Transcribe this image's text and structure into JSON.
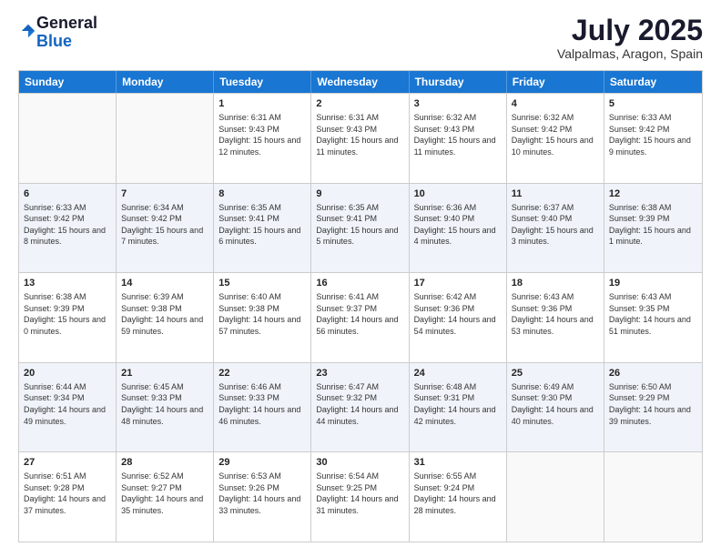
{
  "logo": {
    "general": "General",
    "blue": "Blue"
  },
  "header": {
    "month_year": "July 2025",
    "location": "Valpalmas, Aragon, Spain"
  },
  "days_of_week": [
    "Sunday",
    "Monday",
    "Tuesday",
    "Wednesday",
    "Thursday",
    "Friday",
    "Saturday"
  ],
  "weeks": [
    [
      {
        "day": "",
        "sunrise": "",
        "sunset": "",
        "daylight": "",
        "alt": false
      },
      {
        "day": "",
        "sunrise": "",
        "sunset": "",
        "daylight": "",
        "alt": false
      },
      {
        "day": "1",
        "sunrise": "Sunrise: 6:31 AM",
        "sunset": "Sunset: 9:43 PM",
        "daylight": "Daylight: 15 hours and 12 minutes.",
        "alt": false
      },
      {
        "day": "2",
        "sunrise": "Sunrise: 6:31 AM",
        "sunset": "Sunset: 9:43 PM",
        "daylight": "Daylight: 15 hours and 11 minutes.",
        "alt": false
      },
      {
        "day": "3",
        "sunrise": "Sunrise: 6:32 AM",
        "sunset": "Sunset: 9:43 PM",
        "daylight": "Daylight: 15 hours and 11 minutes.",
        "alt": false
      },
      {
        "day": "4",
        "sunrise": "Sunrise: 6:32 AM",
        "sunset": "Sunset: 9:42 PM",
        "daylight": "Daylight: 15 hours and 10 minutes.",
        "alt": false
      },
      {
        "day": "5",
        "sunrise": "Sunrise: 6:33 AM",
        "sunset": "Sunset: 9:42 PM",
        "daylight": "Daylight: 15 hours and 9 minutes.",
        "alt": false
      }
    ],
    [
      {
        "day": "6",
        "sunrise": "Sunrise: 6:33 AM",
        "sunset": "Sunset: 9:42 PM",
        "daylight": "Daylight: 15 hours and 8 minutes.",
        "alt": true
      },
      {
        "day": "7",
        "sunrise": "Sunrise: 6:34 AM",
        "sunset": "Sunset: 9:42 PM",
        "daylight": "Daylight: 15 hours and 7 minutes.",
        "alt": true
      },
      {
        "day": "8",
        "sunrise": "Sunrise: 6:35 AM",
        "sunset": "Sunset: 9:41 PM",
        "daylight": "Daylight: 15 hours and 6 minutes.",
        "alt": true
      },
      {
        "day": "9",
        "sunrise": "Sunrise: 6:35 AM",
        "sunset": "Sunset: 9:41 PM",
        "daylight": "Daylight: 15 hours and 5 minutes.",
        "alt": true
      },
      {
        "day": "10",
        "sunrise": "Sunrise: 6:36 AM",
        "sunset": "Sunset: 9:40 PM",
        "daylight": "Daylight: 15 hours and 4 minutes.",
        "alt": true
      },
      {
        "day": "11",
        "sunrise": "Sunrise: 6:37 AM",
        "sunset": "Sunset: 9:40 PM",
        "daylight": "Daylight: 15 hours and 3 minutes.",
        "alt": true
      },
      {
        "day": "12",
        "sunrise": "Sunrise: 6:38 AM",
        "sunset": "Sunset: 9:39 PM",
        "daylight": "Daylight: 15 hours and 1 minute.",
        "alt": true
      }
    ],
    [
      {
        "day": "13",
        "sunrise": "Sunrise: 6:38 AM",
        "sunset": "Sunset: 9:39 PM",
        "daylight": "Daylight: 15 hours and 0 minutes.",
        "alt": false
      },
      {
        "day": "14",
        "sunrise": "Sunrise: 6:39 AM",
        "sunset": "Sunset: 9:38 PM",
        "daylight": "Daylight: 14 hours and 59 minutes.",
        "alt": false
      },
      {
        "day": "15",
        "sunrise": "Sunrise: 6:40 AM",
        "sunset": "Sunset: 9:38 PM",
        "daylight": "Daylight: 14 hours and 57 minutes.",
        "alt": false
      },
      {
        "day": "16",
        "sunrise": "Sunrise: 6:41 AM",
        "sunset": "Sunset: 9:37 PM",
        "daylight": "Daylight: 14 hours and 56 minutes.",
        "alt": false
      },
      {
        "day": "17",
        "sunrise": "Sunrise: 6:42 AM",
        "sunset": "Sunset: 9:36 PM",
        "daylight": "Daylight: 14 hours and 54 minutes.",
        "alt": false
      },
      {
        "day": "18",
        "sunrise": "Sunrise: 6:43 AM",
        "sunset": "Sunset: 9:36 PM",
        "daylight": "Daylight: 14 hours and 53 minutes.",
        "alt": false
      },
      {
        "day": "19",
        "sunrise": "Sunrise: 6:43 AM",
        "sunset": "Sunset: 9:35 PM",
        "daylight": "Daylight: 14 hours and 51 minutes.",
        "alt": false
      }
    ],
    [
      {
        "day": "20",
        "sunrise": "Sunrise: 6:44 AM",
        "sunset": "Sunset: 9:34 PM",
        "daylight": "Daylight: 14 hours and 49 minutes.",
        "alt": true
      },
      {
        "day": "21",
        "sunrise": "Sunrise: 6:45 AM",
        "sunset": "Sunset: 9:33 PM",
        "daylight": "Daylight: 14 hours and 48 minutes.",
        "alt": true
      },
      {
        "day": "22",
        "sunrise": "Sunrise: 6:46 AM",
        "sunset": "Sunset: 9:33 PM",
        "daylight": "Daylight: 14 hours and 46 minutes.",
        "alt": true
      },
      {
        "day": "23",
        "sunrise": "Sunrise: 6:47 AM",
        "sunset": "Sunset: 9:32 PM",
        "daylight": "Daylight: 14 hours and 44 minutes.",
        "alt": true
      },
      {
        "day": "24",
        "sunrise": "Sunrise: 6:48 AM",
        "sunset": "Sunset: 9:31 PM",
        "daylight": "Daylight: 14 hours and 42 minutes.",
        "alt": true
      },
      {
        "day": "25",
        "sunrise": "Sunrise: 6:49 AM",
        "sunset": "Sunset: 9:30 PM",
        "daylight": "Daylight: 14 hours and 40 minutes.",
        "alt": true
      },
      {
        "day": "26",
        "sunrise": "Sunrise: 6:50 AM",
        "sunset": "Sunset: 9:29 PM",
        "daylight": "Daylight: 14 hours and 39 minutes.",
        "alt": true
      }
    ],
    [
      {
        "day": "27",
        "sunrise": "Sunrise: 6:51 AM",
        "sunset": "Sunset: 9:28 PM",
        "daylight": "Daylight: 14 hours and 37 minutes.",
        "alt": false
      },
      {
        "day": "28",
        "sunrise": "Sunrise: 6:52 AM",
        "sunset": "Sunset: 9:27 PM",
        "daylight": "Daylight: 14 hours and 35 minutes.",
        "alt": false
      },
      {
        "day": "29",
        "sunrise": "Sunrise: 6:53 AM",
        "sunset": "Sunset: 9:26 PM",
        "daylight": "Daylight: 14 hours and 33 minutes.",
        "alt": false
      },
      {
        "day": "30",
        "sunrise": "Sunrise: 6:54 AM",
        "sunset": "Sunset: 9:25 PM",
        "daylight": "Daylight: 14 hours and 31 minutes.",
        "alt": false
      },
      {
        "day": "31",
        "sunrise": "Sunrise: 6:55 AM",
        "sunset": "Sunset: 9:24 PM",
        "daylight": "Daylight: 14 hours and 28 minutes.",
        "alt": false
      },
      {
        "day": "",
        "sunrise": "",
        "sunset": "",
        "daylight": "",
        "alt": false
      },
      {
        "day": "",
        "sunrise": "",
        "sunset": "",
        "daylight": "",
        "alt": false
      }
    ]
  ]
}
